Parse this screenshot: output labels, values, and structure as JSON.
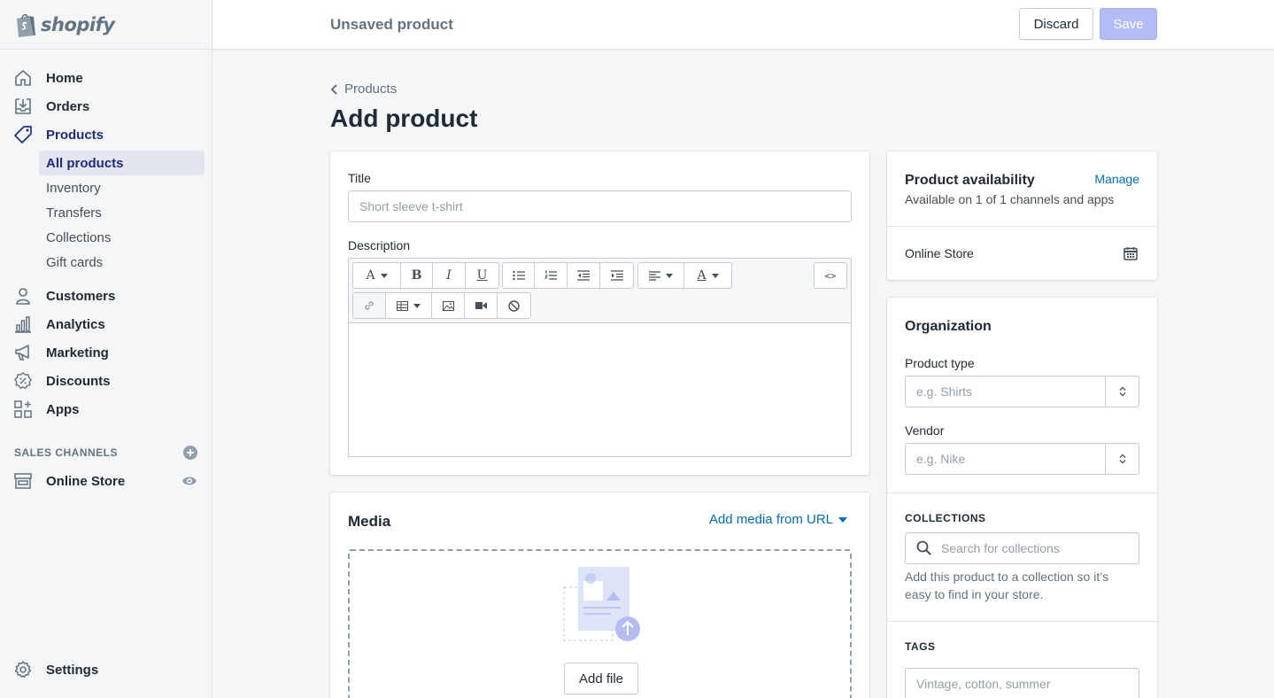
{
  "app": {
    "brand": "shopify",
    "accent": "#5c6ac4"
  },
  "sidebar": {
    "nav": [
      {
        "label": "Home",
        "icon": "home-icon"
      },
      {
        "label": "Orders",
        "icon": "orders-icon"
      },
      {
        "label": "Products",
        "icon": "tag-icon"
      }
    ],
    "products_sub": [
      "All products",
      "Inventory",
      "Transfers",
      "Collections",
      "Gift cards"
    ],
    "nav2": [
      {
        "label": "Customers",
        "icon": "person-icon"
      },
      {
        "label": "Analytics",
        "icon": "bar-chart-icon"
      },
      {
        "label": "Marketing",
        "icon": "megaphone-icon"
      },
      {
        "label": "Discounts",
        "icon": "discount-icon"
      },
      {
        "label": "Apps",
        "icon": "apps-icon"
      }
    ],
    "sales_channels_heading": "SALES CHANNELS",
    "online_store": "Online Store",
    "settings": "Settings"
  },
  "topbar": {
    "title": "Unsaved product",
    "discard": "Discard",
    "save": "Save"
  },
  "page": {
    "breadcrumb": "Products",
    "title": "Add product"
  },
  "product_form": {
    "title_label": "Title",
    "title_placeholder": "Short sleeve t-shirt",
    "description_label": "Description",
    "toolbar": {
      "font": "A",
      "bold": "B",
      "italic": "I",
      "underline": "U",
      "color": "A",
      "html": "<>"
    }
  },
  "media": {
    "heading": "Media",
    "add_from_url": "Add media from URL",
    "add_file": "Add file"
  },
  "availability": {
    "heading": "Product availability",
    "manage": "Manage",
    "summary": "Available on 1 of 1 channels and apps",
    "channel": "Online Store"
  },
  "organization": {
    "heading": "Organization",
    "product_type_label": "Product type",
    "product_type_placeholder": "e.g. Shirts",
    "vendor_label": "Vendor",
    "vendor_placeholder": "e.g. Nike",
    "collections_heading": "COLLECTIONS",
    "collections_placeholder": "Search for collections",
    "collections_help": "Add this product to a collection so it’s easy to find in your store.",
    "tags_heading": "TAGS",
    "tags_placeholder": "Vintage, cotton, summer"
  }
}
